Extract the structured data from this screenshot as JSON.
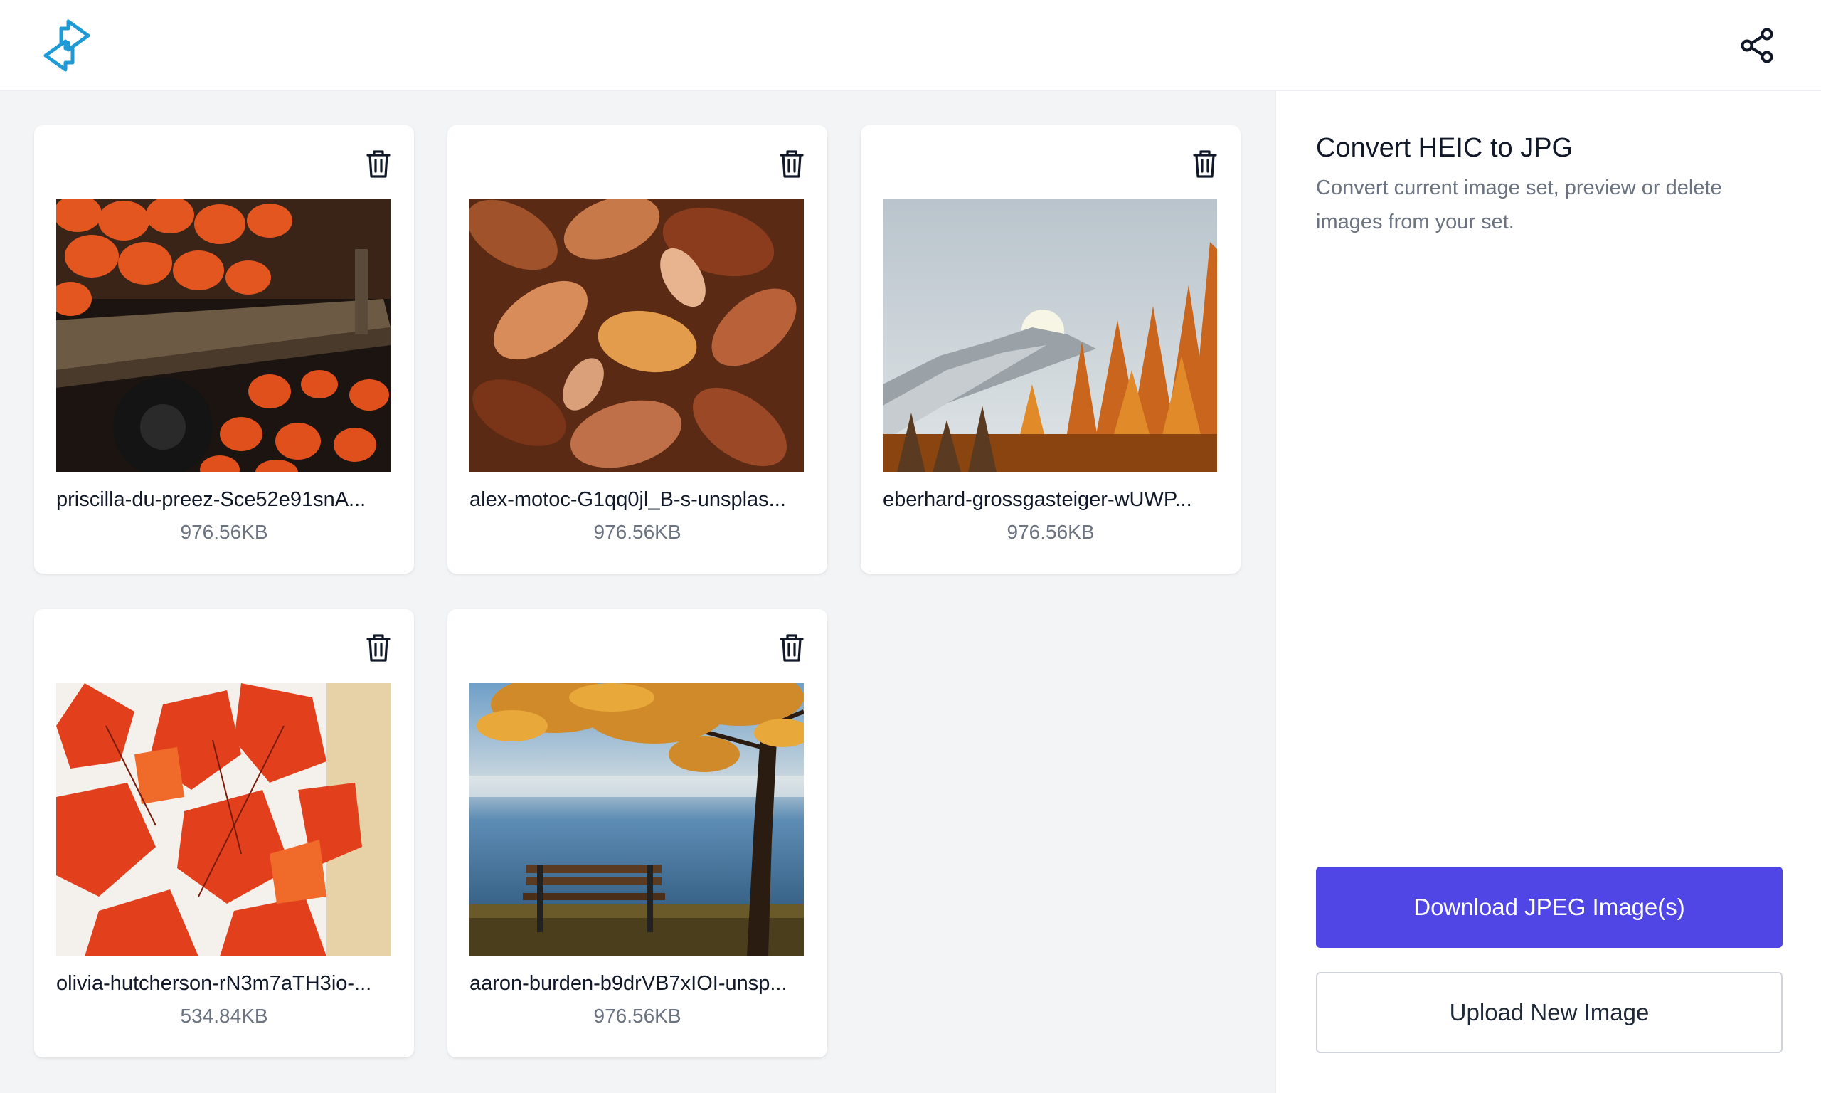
{
  "header": {
    "logo_icon": "swap-arrows-icon",
    "share_icon": "share-icon"
  },
  "colors": {
    "accent": "#4f46e5",
    "logo": "#1e9bd7",
    "muted_text": "#6b7280",
    "background": "#f3f4f6"
  },
  "images": [
    {
      "name": "priscilla-du-preez-Sce52e91snA...",
      "size": "976.56KB",
      "thumbnail": "pumpkins-on-wagon"
    },
    {
      "name": "alex-motoc-G1qq0jl_B-s-unsplas...",
      "size": "976.56KB",
      "thumbnail": "autumn-leaves"
    },
    {
      "name": "eberhard-grossgasteiger-wUWP...",
      "size": "976.56KB",
      "thumbnail": "mountain-autumn-forest"
    },
    {
      "name": "olivia-hutcherson-rN3m7aTH3io-...",
      "size": "534.84KB",
      "thumbnail": "red-maple-leaves"
    },
    {
      "name": "aaron-burden-b9drVB7xIOI-unsp...",
      "size": "976.56KB",
      "thumbnail": "lake-bench-tree"
    }
  ],
  "sidebar": {
    "title": "Convert HEIC to JPG",
    "description": "Convert current image set, preview or delete images from your set.",
    "download_label": "Download JPEG Image(s)",
    "upload_label": "Upload New Image"
  }
}
